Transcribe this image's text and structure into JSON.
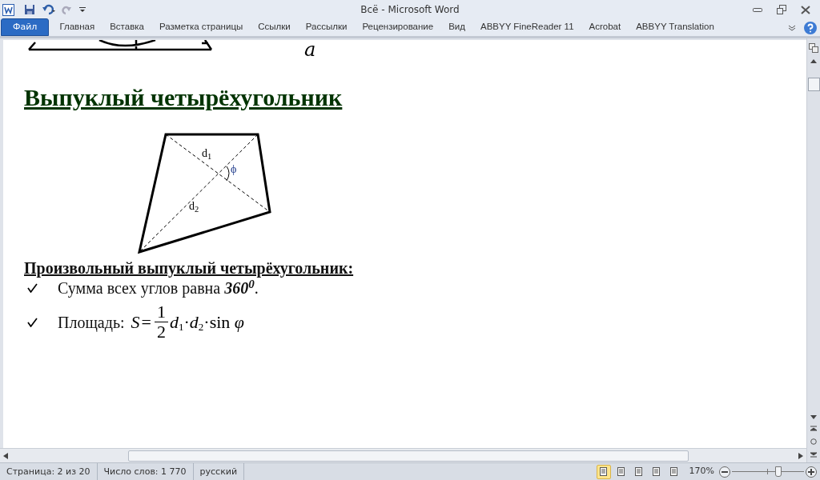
{
  "window": {
    "title": "Всё - Microsoft Word"
  },
  "tabs": [
    {
      "label": "Файл",
      "kind": "file"
    },
    {
      "label": "Главная",
      "kind": "tab"
    },
    {
      "label": "Вставка",
      "kind": "tab"
    },
    {
      "label": "Разметка страницы",
      "kind": "tab"
    },
    {
      "label": "Ссылки",
      "kind": "tab"
    },
    {
      "label": "Рассылки",
      "kind": "tab"
    },
    {
      "label": "Рецензирование",
      "kind": "tab"
    },
    {
      "label": "Вид",
      "kind": "tab"
    },
    {
      "label": "ABBYY FineReader 11",
      "kind": "tab"
    },
    {
      "label": "Acrobat",
      "kind": "tab"
    },
    {
      "label": "ABBYY Translation",
      "kind": "tab"
    }
  ],
  "document": {
    "top_figure_label": "a",
    "heading": "Выпуклый четырёхугольник",
    "diagram": {
      "labels": [
        "d$_{1}$",
        "ϕ",
        "d$_{2}$"
      ]
    },
    "subheading": "Произвольный выпуклый четырёхугольник:",
    "bullets": [
      {
        "kind": "text",
        "text": "Сумма всех углов равна **360**$^{0}$."
      },
      {
        "kind": "formula",
        "text": "Площадь:",
        "formula": {
          "lhs": "S",
          "eq": "=",
          "numerator": "1",
          "denominator": "2",
          "rest": "*d*$_{1}$·*d*$_{2}$·sin *φ*"
        }
      }
    ]
  },
  "status_bar": {
    "items": [
      "Страница: 2 из 20",
      "Число слов: 1 770",
      "русский"
    ],
    "views": [
      {
        "selected": true
      },
      {
        "selected": false
      },
      {
        "selected": false
      },
      {
        "selected": false
      },
      {
        "selected": false
      }
    ],
    "zoom": "170%",
    "zoom_slider": {
      "level": 0.65
    }
  }
}
